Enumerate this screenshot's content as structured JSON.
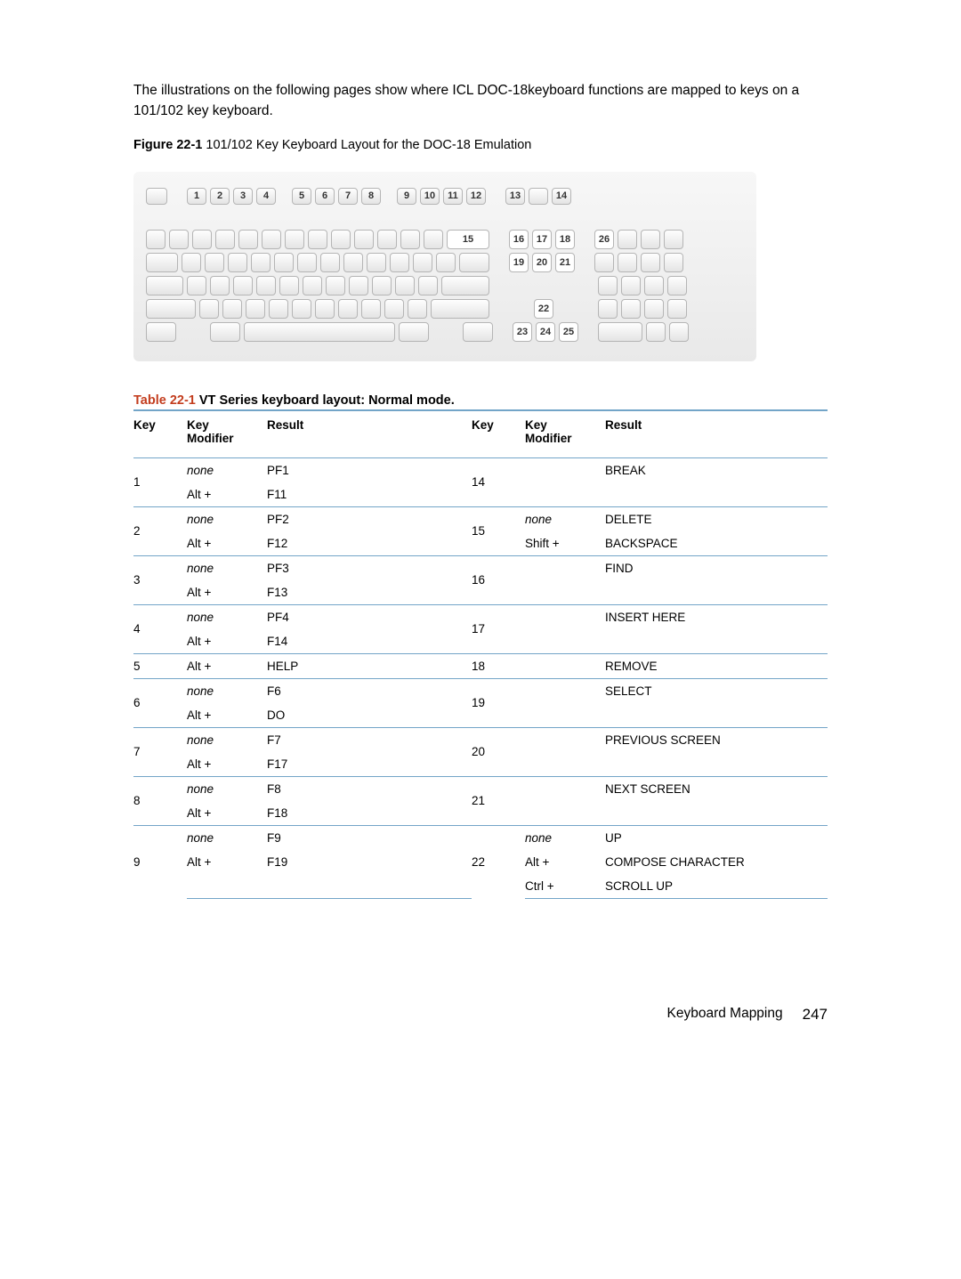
{
  "intro": "The illustrations on the following pages show where ICL DOC-18keyboard functions are mapped to keys on a 101/102 key keyboard.",
  "figure": {
    "label": "Figure 22-1",
    "caption": "  101/102 Key Keyboard Layout for the DOC-18 Emulation"
  },
  "kbd_top_nums": [
    "1",
    "2",
    "3",
    "4",
    "5",
    "6",
    "7",
    "8",
    "9",
    "10",
    "11",
    "12",
    "13",
    "",
    "14"
  ],
  "kbd_labels": {
    "r1_15": "15",
    "r1_c": [
      "16",
      "17",
      "18"
    ],
    "r1_26": "26",
    "r2_c": [
      "19",
      "20",
      "21"
    ],
    "r4_22": "22",
    "r5_c": [
      "23",
      "24",
      "25"
    ]
  },
  "table": {
    "label": "Table 22-1",
    "title": "  VT Series keyboard layout: Normal mode.",
    "headers": [
      "Key",
      "Key Modifier",
      "Result",
      "Key",
      "Key Modifier",
      "Result"
    ],
    "groups": [
      {
        "left": {
          "key": "1",
          "rows": [
            [
              "none",
              "PF1"
            ],
            [
              "Alt +",
              "F11"
            ]
          ]
        },
        "right": {
          "key": "14",
          "rows": [
            [
              "",
              "BREAK"
            ]
          ]
        }
      },
      {
        "left": {
          "key": "2",
          "rows": [
            [
              "none",
              "PF2"
            ],
            [
              "Alt +",
              "F12"
            ]
          ]
        },
        "right": {
          "key": "15",
          "rows": [
            [
              "none",
              "DELETE"
            ],
            [
              "Shift +",
              "BACKSPACE"
            ]
          ]
        }
      },
      {
        "left": {
          "key": "3",
          "rows": [
            [
              "none",
              "PF3"
            ],
            [
              "Alt +",
              "F13"
            ]
          ]
        },
        "right": {
          "key": "16",
          "rows": [
            [
              "",
              "FIND"
            ]
          ]
        }
      },
      {
        "left": {
          "key": "4",
          "rows": [
            [
              "none",
              "PF4"
            ],
            [
              "Alt +",
              "F14"
            ]
          ]
        },
        "right": {
          "key": "17",
          "rows": [
            [
              "",
              "INSERT HERE"
            ]
          ]
        }
      },
      {
        "left": {
          "key": "5",
          "rows": [
            [
              "Alt +",
              "HELP"
            ]
          ]
        },
        "right": {
          "key": "18",
          "rows": [
            [
              "",
              "REMOVE"
            ]
          ]
        }
      },
      {
        "left": {
          "key": "6",
          "rows": [
            [
              "none",
              "F6"
            ],
            [
              "Alt +",
              "DO"
            ]
          ]
        },
        "right": {
          "key": "19",
          "rows": [
            [
              "",
              "SELECT"
            ]
          ]
        }
      },
      {
        "left": {
          "key": "7",
          "rows": [
            [
              "none",
              "F7"
            ],
            [
              "Alt +",
              "F17"
            ]
          ]
        },
        "right": {
          "key": "20",
          "rows": [
            [
              "",
              "PREVIOUS SCREEN"
            ]
          ]
        }
      },
      {
        "left": {
          "key": "8",
          "rows": [
            [
              "none",
              "F8"
            ],
            [
              "Alt +",
              "F18"
            ]
          ]
        },
        "right": {
          "key": "21",
          "rows": [
            [
              "",
              "NEXT SCREEN"
            ]
          ]
        }
      },
      {
        "left": {
          "key": "9",
          "rows": [
            [
              "none",
              "F9"
            ],
            [
              "Alt +",
              "F19"
            ]
          ]
        },
        "right": {
          "key": "22",
          "rows": [
            [
              "none",
              "UP"
            ],
            [
              "Alt +",
              "COMPOSE CHARACTER"
            ],
            [
              "Ctrl +",
              "SCROLL UP"
            ]
          ]
        }
      }
    ]
  },
  "footer": {
    "section": "Keyboard Mapping",
    "page": "247"
  }
}
